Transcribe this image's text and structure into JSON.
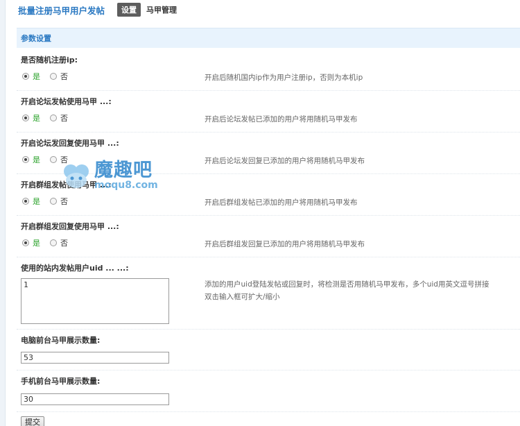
{
  "header": {
    "title": "批量注册马甲用户发帖",
    "tabs": [
      {
        "label": "设置",
        "active": true
      },
      {
        "label": "马甲管理",
        "active": false
      }
    ]
  },
  "section": {
    "title": "参数设置"
  },
  "settings": [
    {
      "label": "是否随机注册ip:",
      "yes_label": "是",
      "no_label": "否",
      "selected": "yes",
      "description": "开启后随机国内ip作为用户注册ip，否则为本机ip"
    },
    {
      "label": "开启论坛发帖使用马甲 ...:",
      "yes_label": "是",
      "no_label": "否",
      "selected": "yes",
      "description": "开启后论坛发帖已添加的用户将用随机马甲发布"
    },
    {
      "label": "开启论坛发回复使用马甲 ...:",
      "yes_label": "是",
      "no_label": "否",
      "selected": "yes",
      "description": "开启后论坛发回复已添加的用户将用随机马甲发布"
    },
    {
      "label": "开启群组发帖使用马甲 ...:",
      "yes_label": "是",
      "no_label": "否",
      "selected": "yes",
      "description": "开启后群组发帖已添加的用户将用随机马甲发布"
    },
    {
      "label": "开启群组发回复使用马甲 ...:",
      "yes_label": "是",
      "no_label": "否",
      "selected": "yes",
      "description": "开启后群组发回复已添加的用户将用随机马甲发布"
    }
  ],
  "uid_setting": {
    "label": "使用的站内发帖用户uid ... ...:",
    "value": "1",
    "description_line1": "添加的用户uid登陆发帖或回复时，将检测是否用随机马甲发布，多个uid用英文逗号拼接",
    "description_line2": "双击输入框可扩大/缩小"
  },
  "pc_count": {
    "label": "电脑前台马甲展示数量:",
    "value": "53"
  },
  "mobile_count": {
    "label": "手机前台马甲展示数量:",
    "value": "30"
  },
  "submit_label": "提交",
  "watermark": {
    "cn": "魔趣吧",
    "en": "moqu8.com"
  },
  "colors": {
    "accent": "#2b79c2",
    "section_bg": "#e8f3fd",
    "yes_green": "#2ba22b"
  }
}
